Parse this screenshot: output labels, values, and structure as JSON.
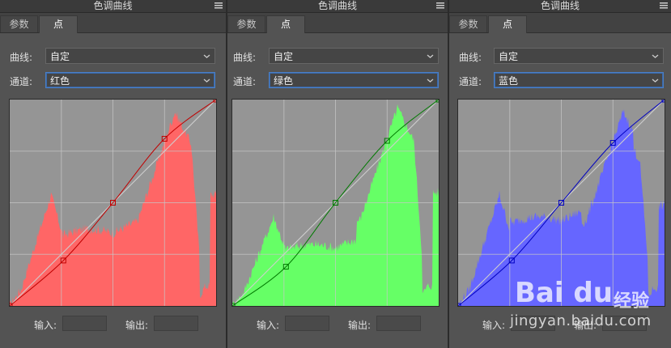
{
  "colors": {
    "red_fill": "#ff6666",
    "green_fill": "#66ff66",
    "blue_fill": "#6666ff",
    "red_curve": "#c00000",
    "green_curve": "#007a00",
    "blue_curve": "#0000c0",
    "graph_bg": "#959595"
  },
  "panels": [
    {
      "title": "色调曲线",
      "tabs": [
        {
          "label": "参数"
        },
        {
          "label": "点"
        }
      ],
      "curve_label": "曲线:",
      "curve_value": "自定",
      "channel_label": "通道:",
      "channel_value": "红色",
      "input_label": "输入:",
      "output_label": "输出:",
      "channel": "red",
      "curve_points": [
        [
          0,
          0
        ],
        [
          0.26,
          0.22
        ],
        [
          0.5,
          0.5
        ],
        [
          0.75,
          0.81
        ],
        [
          1,
          1
        ]
      ]
    },
    {
      "title": "色调曲线",
      "tabs": [
        {
          "label": "参数"
        },
        {
          "label": "点"
        }
      ],
      "curve_label": "曲线:",
      "curve_value": "自定",
      "channel_label": "通道:",
      "channel_value": "绿色",
      "input_label": "输入:",
      "output_label": "输出:",
      "channel": "green",
      "curve_points": [
        [
          0,
          0
        ],
        [
          0.26,
          0.19
        ],
        [
          0.5,
          0.5
        ],
        [
          0.75,
          0.8
        ],
        [
          1,
          1
        ]
      ]
    },
    {
      "title": "色调曲线",
      "tabs": [
        {
          "label": "参数"
        },
        {
          "label": "点"
        }
      ],
      "curve_label": "曲线:",
      "curve_value": "自定",
      "channel_label": "通道:",
      "channel_value": "蓝色",
      "input_label": "输入:",
      "output_label": "输出:",
      "channel": "blue",
      "curve_points": [
        [
          0,
          0
        ],
        [
          0.26,
          0.22
        ],
        [
          0.5,
          0.5
        ],
        [
          0.75,
          0.79
        ],
        [
          1,
          1
        ]
      ]
    }
  ],
  "watermark": {
    "logo": "Bai du",
    "cn": "经验",
    "url": "jingyan.baidu.com"
  }
}
